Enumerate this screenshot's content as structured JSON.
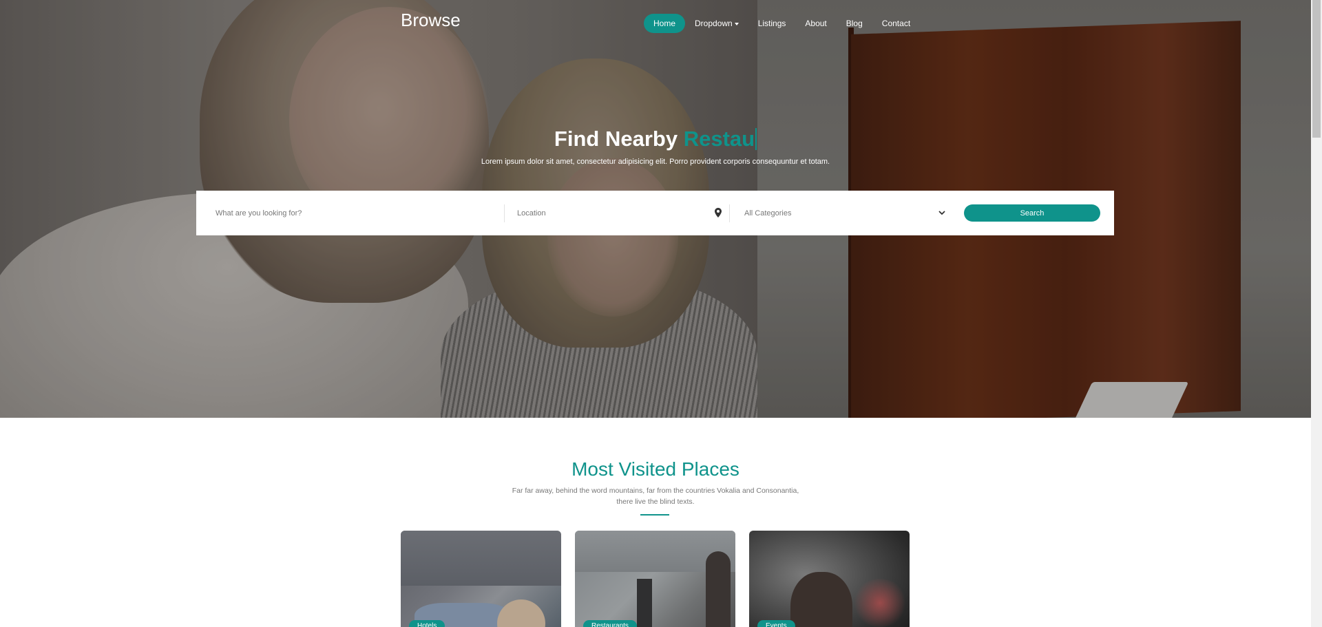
{
  "brand": "Browse",
  "nav": {
    "items": [
      {
        "label": "Home",
        "active": true
      },
      {
        "label": "Dropdown",
        "has_caret": true
      },
      {
        "label": "Listings"
      },
      {
        "label": "About"
      },
      {
        "label": "Blog"
      },
      {
        "label": "Contact"
      }
    ]
  },
  "hero": {
    "title_prefix": "Find Nearby",
    "title_typed": "Restau",
    "subtitle": "Lorem ipsum dolor sit amet, consectetur adipisicing elit. Porro provident corporis consequuntur et totam."
  },
  "search": {
    "keyword_placeholder": "What are you looking for?",
    "location_placeholder": "Location",
    "category_selected": "All Categories",
    "button_label": "Search",
    "icons": [
      "map-pin-icon",
      "chevron-down-icon"
    ]
  },
  "section": {
    "title": "Most Visited Places",
    "subtitle_line1": "Far far away, behind the word mountains, far from the countries Vokalia and Consonantia,",
    "subtitle_line2": "there live the blind texts."
  },
  "cards": [
    {
      "badge": "Hotels"
    },
    {
      "badge": "Restaurants"
    },
    {
      "badge": "Events"
    }
  ],
  "colors": {
    "accent": "#0f938b",
    "text_muted": "#777777"
  }
}
